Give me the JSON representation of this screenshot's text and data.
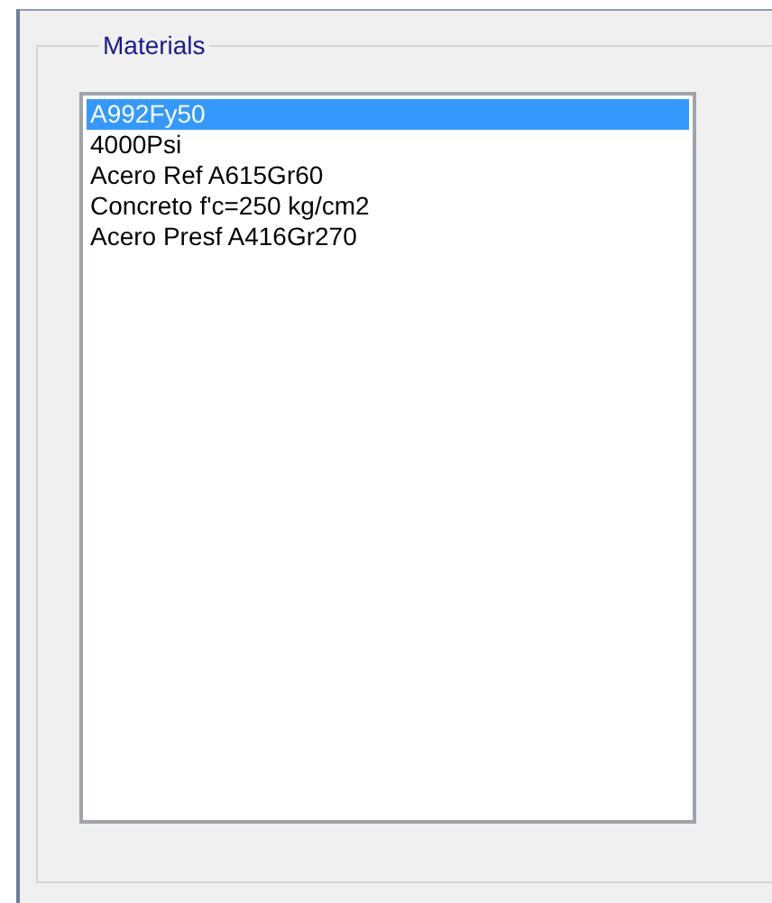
{
  "group": {
    "title": "Materials"
  },
  "materials": [
    {
      "name": "A992Fy50",
      "selected": true
    },
    {
      "name": "4000Psi",
      "selected": false
    },
    {
      "name": "Acero Ref A615Gr60",
      "selected": false
    },
    {
      "name": "Concreto f'c=250 kg/cm2",
      "selected": false
    },
    {
      "name": "Acero Presf A416Gr270",
      "selected": false
    }
  ]
}
